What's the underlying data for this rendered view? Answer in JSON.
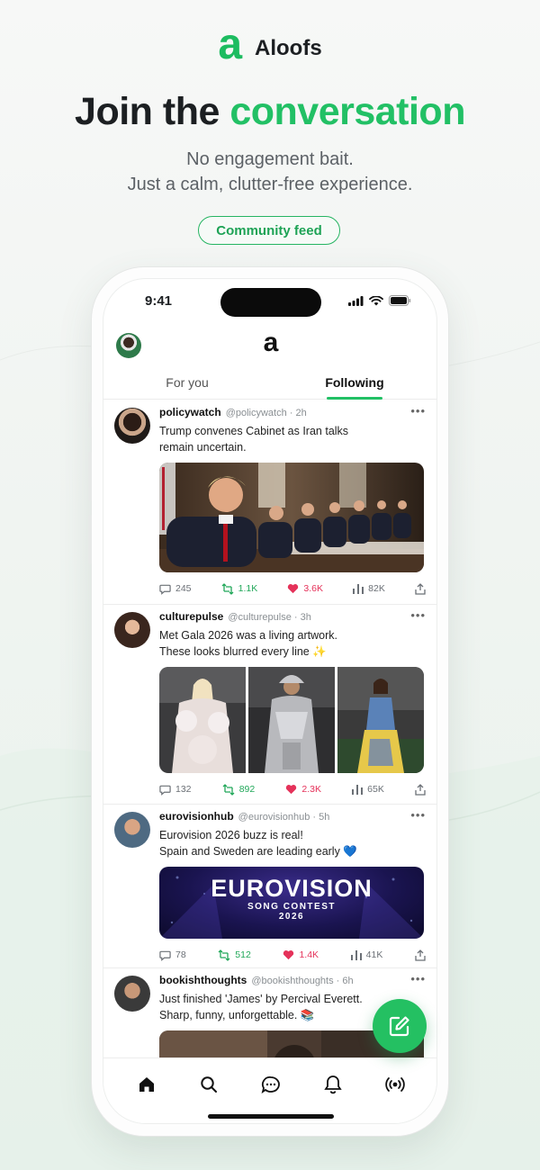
{
  "brand": {
    "logo_glyph": "a",
    "name": "Aloofs",
    "accent_color": "#22c065"
  },
  "headline": {
    "prefix": "Join the",
    "accent": "conversation"
  },
  "subheadline": {
    "line1": "No engagement bait.",
    "line2": "Just a calm, clutter-free experience."
  },
  "pill": {
    "label": "Community feed"
  },
  "phone": {
    "status_time": "9:41",
    "header_logo": "a",
    "tabs": [
      {
        "label": "For you",
        "active": false
      },
      {
        "label": "Following",
        "active": true
      }
    ],
    "posts": [
      {
        "name": "policywatch",
        "handle": "@policywatch · 2h",
        "text_lines": [
          "Trump convenes Cabinet as Iran talks",
          "remain uncertain."
        ],
        "media": "photo-cabinet-meeting",
        "replies": "245",
        "reposts": "1.1K",
        "likes": "3.6K",
        "views": "82K"
      },
      {
        "name": "culturepulse",
        "handle": "@culturepulse · 3h",
        "text_lines": [
          "Met Gala 2026 was a living artwork.",
          "These looks blurred every line ✨"
        ],
        "media": "photo-grid-met-gala",
        "replies": "132",
        "reposts": "892",
        "likes": "2.3K",
        "views": "65K"
      },
      {
        "name": "eurovisionhub",
        "handle": "@eurovisionhub · 5h",
        "text_lines": [
          "Eurovision 2026 buzz is real!",
          "Spain and Sweden are leading early 💙"
        ],
        "media": "banner-eurovision",
        "banner_title": "EUROVISION",
        "banner_sub": "SONG CONTEST",
        "banner_year": "2026",
        "replies": "78",
        "reposts": "512",
        "likes": "1.4K",
        "views": "41K"
      },
      {
        "name": "bookishthoughts",
        "handle": "@bookishthoughts · 6h",
        "text_lines": [
          "Just finished 'James' by Percival Everett.",
          "Sharp, funny, unforgettable. 📚"
        ],
        "media": "photo-book"
      }
    ],
    "nav": [
      "home-icon",
      "search-icon",
      "messages-icon",
      "notifications-icon",
      "broadcast-icon"
    ],
    "fab": "compose-icon"
  }
}
